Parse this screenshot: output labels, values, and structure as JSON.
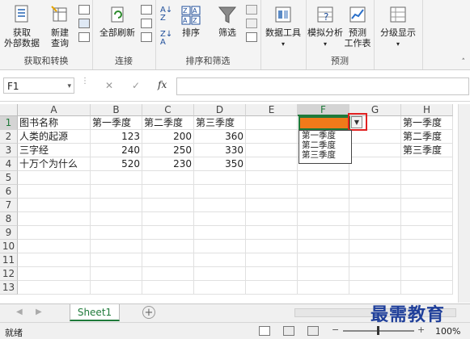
{
  "ribbon": {
    "groups": [
      {
        "label": "获取和转换",
        "buttons": [
          {
            "label": "获取\n外部数据",
            "icon": "get-external-data-icon"
          },
          {
            "label": "新建\n查询",
            "icon": "new-query-icon"
          }
        ]
      },
      {
        "label": "连接",
        "buttons": [
          {
            "label": "全部刷新",
            "icon": "refresh-all-icon"
          }
        ]
      },
      {
        "label": "排序和筛选",
        "buttons": [
          {
            "label": "排序",
            "icon": "sort-icon"
          },
          {
            "label": "筛选",
            "icon": "filter-icon"
          }
        ]
      },
      {
        "label": "",
        "buttons": [
          {
            "label": "数据工具",
            "icon": "data-tools-icon"
          }
        ]
      },
      {
        "label": "预测",
        "buttons": [
          {
            "label": "模拟分析",
            "icon": "what-if-icon"
          },
          {
            "label": "预测\n工作表",
            "icon": "forecast-sheet-icon"
          }
        ]
      },
      {
        "label": "",
        "buttons": [
          {
            "label": "分级显示",
            "icon": "outline-icon"
          }
        ]
      }
    ]
  },
  "formula_bar": {
    "name_box": "F1",
    "fx": "fx",
    "cancel": "✕",
    "enter": "✓",
    "value": ""
  },
  "columns": [
    "A",
    "B",
    "C",
    "D",
    "E",
    "F",
    "G",
    "H"
  ],
  "rows": [
    "1",
    "2",
    "3",
    "4",
    "5",
    "6",
    "7",
    "8",
    "9",
    "10",
    "11",
    "12",
    "13"
  ],
  "table": [
    [
      "图书名称",
      "第一季度",
      "第二季度",
      "第三季度"
    ],
    [
      "人类的起源",
      "123",
      "200",
      "360"
    ],
    [
      "三字经",
      "240",
      "250",
      "330"
    ],
    [
      "十万个为什么",
      "520",
      "230",
      "350"
    ]
  ],
  "h_column": [
    "第一季度",
    "第二季度",
    "第三季度"
  ],
  "dropdown": {
    "options": [
      "第一季度",
      "第二季度",
      "第三季度"
    ],
    "highlight_color": "#f07a1a",
    "callout_color": "#e02020"
  },
  "sheet_tabs": {
    "active": "Sheet1"
  },
  "status_bar": {
    "ready": "就绪",
    "zoom": "100%"
  },
  "watermark": "最需教育"
}
